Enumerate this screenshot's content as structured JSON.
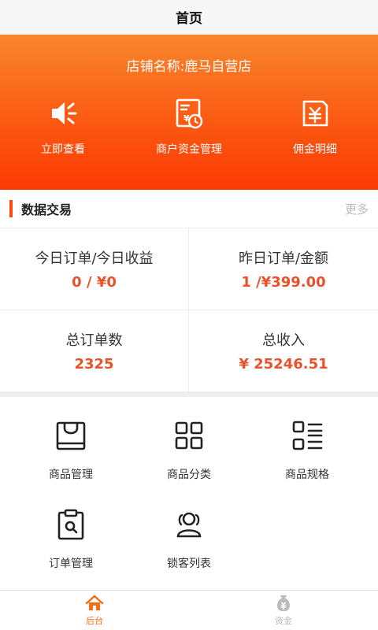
{
  "navbar": {
    "title": "首页"
  },
  "hero": {
    "store_name": "店铺名称:鹿马自营店",
    "actions": [
      {
        "label": "立即查看",
        "icon": "speaker-icon"
      },
      {
        "label": "商户资金管理",
        "icon": "finance-document-icon"
      },
      {
        "label": "佣金明细",
        "icon": "yen-wallet-icon"
      }
    ]
  },
  "section": {
    "title": "数据交易",
    "more": "更多"
  },
  "stats": [
    {
      "label": "今日订单/今日收益",
      "value": "0 / ¥0"
    },
    {
      "label": "昨日订单/金额",
      "value": "1 /¥399.00"
    },
    {
      "label": "总订单数",
      "value": "2325"
    },
    {
      "label": "总收入",
      "value": "¥ 25246.51"
    }
  ],
  "grid": [
    {
      "label": "商品管理",
      "icon": "shopping-bag-icon"
    },
    {
      "label": "商品分类",
      "icon": "category-grid-icon"
    },
    {
      "label": "商品规格",
      "icon": "spec-list-icon"
    },
    {
      "label": "订单管理",
      "icon": "order-clipboard-icon"
    },
    {
      "label": "锁客列表",
      "icon": "users-icon"
    }
  ],
  "tabbar": [
    {
      "label": "后台",
      "icon": "home-icon",
      "active": true
    },
    {
      "label": "资金",
      "icon": "money-bag-icon",
      "active": false
    }
  ],
  "colors": {
    "accent": "#fc4a0a",
    "value": "#e8512a",
    "tab_active": "#f76c10",
    "tab_inactive": "#bbbbbb"
  }
}
